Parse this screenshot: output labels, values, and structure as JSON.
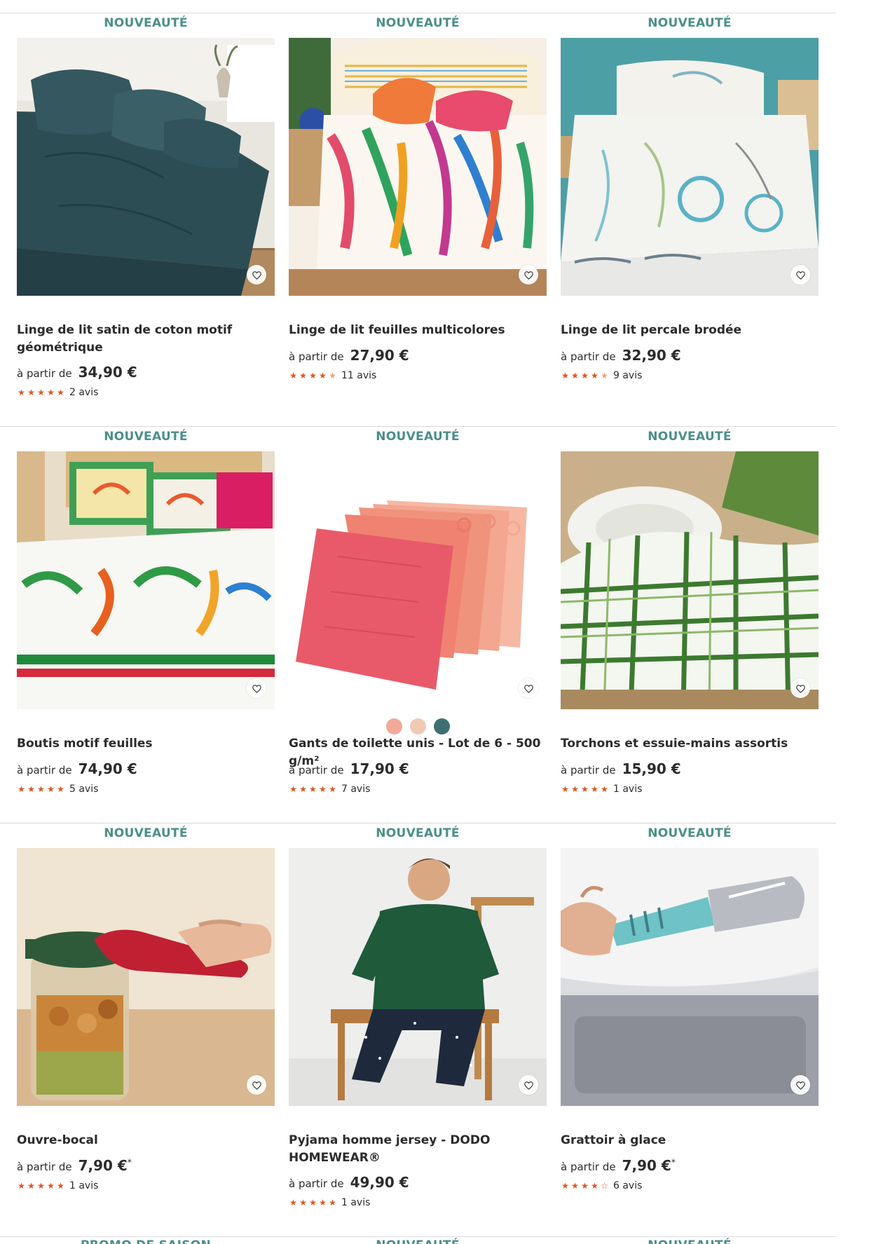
{
  "colors": {
    "badge_new": "#4a8f8a",
    "badge_promo": "#4a8f8a",
    "star": "#e2521f",
    "divider": "#d9d9d9"
  },
  "products": [
    {
      "badge": "NOUVEAUTÉ",
      "title": "Linge de lit satin de coton motif géométrique",
      "from_label": "à partir de",
      "price": "34,90 €",
      "price_note": "",
      "rating": 5,
      "reviews": "2 avis",
      "image": "dark-teal-bedding"
    },
    {
      "badge": "NOUVEAUTÉ",
      "title": "Linge de lit feuilles multicolores",
      "from_label": "à partir de",
      "price": "27,90 €",
      "price_note": "",
      "rating": 4.5,
      "reviews": "11 avis",
      "image": "multicolor-leaf-bedding"
    },
    {
      "badge": "NOUVEAUTÉ",
      "title": "Linge de lit percale brodée",
      "from_label": "à partir de",
      "price": "32,90 €",
      "price_note": "",
      "rating": 4.5,
      "reviews": "9 avis",
      "image": "white-embroidered-bedding"
    },
    {
      "badge": "NOUVEAUTÉ",
      "title": "Boutis motif feuilles",
      "from_label": "à partir de",
      "price": "74,90 €",
      "price_note": "",
      "rating": 5,
      "reviews": "5 avis",
      "image": "leaf-quilt-bed"
    },
    {
      "badge": "NOUVEAUTÉ",
      "title": "Gants de toilette unis - Lot de 6 - 500 g/m²",
      "from_label": "à partir de",
      "price": "17,90 €",
      "price_note": "",
      "rating": 5,
      "reviews": "7 avis",
      "image": "pink-wash-mitts",
      "swatches": [
        "#f2a99a",
        "#efc9b4",
        "#3d6f72"
      ]
    },
    {
      "badge": "NOUVEAUTÉ",
      "title": "Torchons et essuie-mains assortis",
      "from_label": "à partir de",
      "price": "15,90 €",
      "price_note": "",
      "rating": 5,
      "reviews": "1 avis",
      "image": "green-check-towels"
    },
    {
      "badge": "NOUVEAUTÉ",
      "title": "Ouvre-bocal",
      "from_label": "à partir de",
      "price": "7,90 €",
      "price_note": "*",
      "rating": 5,
      "reviews": "1 avis",
      "image": "jar-opener"
    },
    {
      "badge": "NOUVEAUTÉ",
      "title": "Pyjama homme jersey - DODO HOMEWEAR®",
      "from_label": "à partir de",
      "price": "49,90 €",
      "price_note": "",
      "rating": 5,
      "reviews": "1 avis",
      "image": "man-pyjama"
    },
    {
      "badge": "NOUVEAUTÉ",
      "title": "Grattoir à glace",
      "from_label": "à partir de",
      "price": "7,90 €",
      "price_note": "*",
      "rating": 4,
      "reviews": "6 avis",
      "image": "ice-scraper"
    }
  ],
  "next_row_badges": [
    "PROMO DE SAISON",
    "NOUVEAUTÉ",
    "NOUVEAUTÉ"
  ]
}
